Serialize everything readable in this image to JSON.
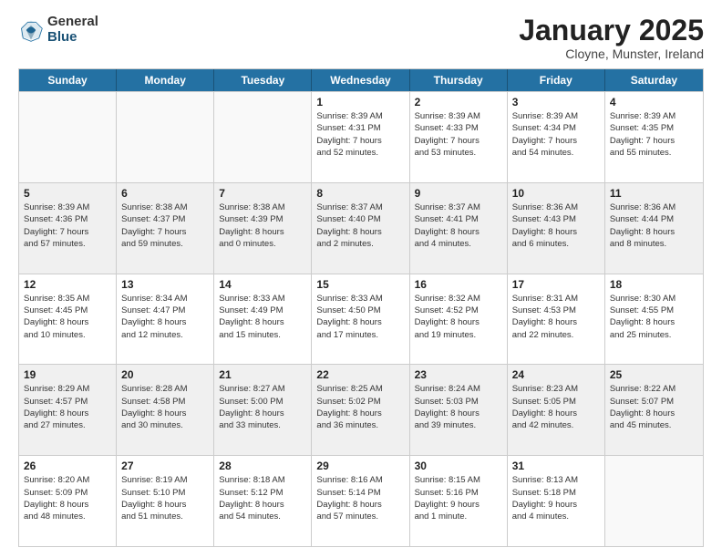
{
  "logo": {
    "general": "General",
    "blue": "Blue"
  },
  "title": "January 2025",
  "subtitle": "Cloyne, Munster, Ireland",
  "header_days": [
    "Sunday",
    "Monday",
    "Tuesday",
    "Wednesday",
    "Thursday",
    "Friday",
    "Saturday"
  ],
  "weeks": [
    [
      {
        "day": "",
        "info": ""
      },
      {
        "day": "",
        "info": ""
      },
      {
        "day": "",
        "info": ""
      },
      {
        "day": "1",
        "info": "Sunrise: 8:39 AM\nSunset: 4:31 PM\nDaylight: 7 hours\nand 52 minutes."
      },
      {
        "day": "2",
        "info": "Sunrise: 8:39 AM\nSunset: 4:33 PM\nDaylight: 7 hours\nand 53 minutes."
      },
      {
        "day": "3",
        "info": "Sunrise: 8:39 AM\nSunset: 4:34 PM\nDaylight: 7 hours\nand 54 minutes."
      },
      {
        "day": "4",
        "info": "Sunrise: 8:39 AM\nSunset: 4:35 PM\nDaylight: 7 hours\nand 55 minutes."
      }
    ],
    [
      {
        "day": "5",
        "info": "Sunrise: 8:39 AM\nSunset: 4:36 PM\nDaylight: 7 hours\nand 57 minutes."
      },
      {
        "day": "6",
        "info": "Sunrise: 8:38 AM\nSunset: 4:37 PM\nDaylight: 7 hours\nand 59 minutes."
      },
      {
        "day": "7",
        "info": "Sunrise: 8:38 AM\nSunset: 4:39 PM\nDaylight: 8 hours\nand 0 minutes."
      },
      {
        "day": "8",
        "info": "Sunrise: 8:37 AM\nSunset: 4:40 PM\nDaylight: 8 hours\nand 2 minutes."
      },
      {
        "day": "9",
        "info": "Sunrise: 8:37 AM\nSunset: 4:41 PM\nDaylight: 8 hours\nand 4 minutes."
      },
      {
        "day": "10",
        "info": "Sunrise: 8:36 AM\nSunset: 4:43 PM\nDaylight: 8 hours\nand 6 minutes."
      },
      {
        "day": "11",
        "info": "Sunrise: 8:36 AM\nSunset: 4:44 PM\nDaylight: 8 hours\nand 8 minutes."
      }
    ],
    [
      {
        "day": "12",
        "info": "Sunrise: 8:35 AM\nSunset: 4:45 PM\nDaylight: 8 hours\nand 10 minutes."
      },
      {
        "day": "13",
        "info": "Sunrise: 8:34 AM\nSunset: 4:47 PM\nDaylight: 8 hours\nand 12 minutes."
      },
      {
        "day": "14",
        "info": "Sunrise: 8:33 AM\nSunset: 4:49 PM\nDaylight: 8 hours\nand 15 minutes."
      },
      {
        "day": "15",
        "info": "Sunrise: 8:33 AM\nSunset: 4:50 PM\nDaylight: 8 hours\nand 17 minutes."
      },
      {
        "day": "16",
        "info": "Sunrise: 8:32 AM\nSunset: 4:52 PM\nDaylight: 8 hours\nand 19 minutes."
      },
      {
        "day": "17",
        "info": "Sunrise: 8:31 AM\nSunset: 4:53 PM\nDaylight: 8 hours\nand 22 minutes."
      },
      {
        "day": "18",
        "info": "Sunrise: 8:30 AM\nSunset: 4:55 PM\nDaylight: 8 hours\nand 25 minutes."
      }
    ],
    [
      {
        "day": "19",
        "info": "Sunrise: 8:29 AM\nSunset: 4:57 PM\nDaylight: 8 hours\nand 27 minutes."
      },
      {
        "day": "20",
        "info": "Sunrise: 8:28 AM\nSunset: 4:58 PM\nDaylight: 8 hours\nand 30 minutes."
      },
      {
        "day": "21",
        "info": "Sunrise: 8:27 AM\nSunset: 5:00 PM\nDaylight: 8 hours\nand 33 minutes."
      },
      {
        "day": "22",
        "info": "Sunrise: 8:25 AM\nSunset: 5:02 PM\nDaylight: 8 hours\nand 36 minutes."
      },
      {
        "day": "23",
        "info": "Sunrise: 8:24 AM\nSunset: 5:03 PM\nDaylight: 8 hours\nand 39 minutes."
      },
      {
        "day": "24",
        "info": "Sunrise: 8:23 AM\nSunset: 5:05 PM\nDaylight: 8 hours\nand 42 minutes."
      },
      {
        "day": "25",
        "info": "Sunrise: 8:22 AM\nSunset: 5:07 PM\nDaylight: 8 hours\nand 45 minutes."
      }
    ],
    [
      {
        "day": "26",
        "info": "Sunrise: 8:20 AM\nSunset: 5:09 PM\nDaylight: 8 hours\nand 48 minutes."
      },
      {
        "day": "27",
        "info": "Sunrise: 8:19 AM\nSunset: 5:10 PM\nDaylight: 8 hours\nand 51 minutes."
      },
      {
        "day": "28",
        "info": "Sunrise: 8:18 AM\nSunset: 5:12 PM\nDaylight: 8 hours\nand 54 minutes."
      },
      {
        "day": "29",
        "info": "Sunrise: 8:16 AM\nSunset: 5:14 PM\nDaylight: 8 hours\nand 57 minutes."
      },
      {
        "day": "30",
        "info": "Sunrise: 8:15 AM\nSunset: 5:16 PM\nDaylight: 9 hours\nand 1 minute."
      },
      {
        "day": "31",
        "info": "Sunrise: 8:13 AM\nSunset: 5:18 PM\nDaylight: 9 hours\nand 4 minutes."
      },
      {
        "day": "",
        "info": ""
      }
    ]
  ]
}
